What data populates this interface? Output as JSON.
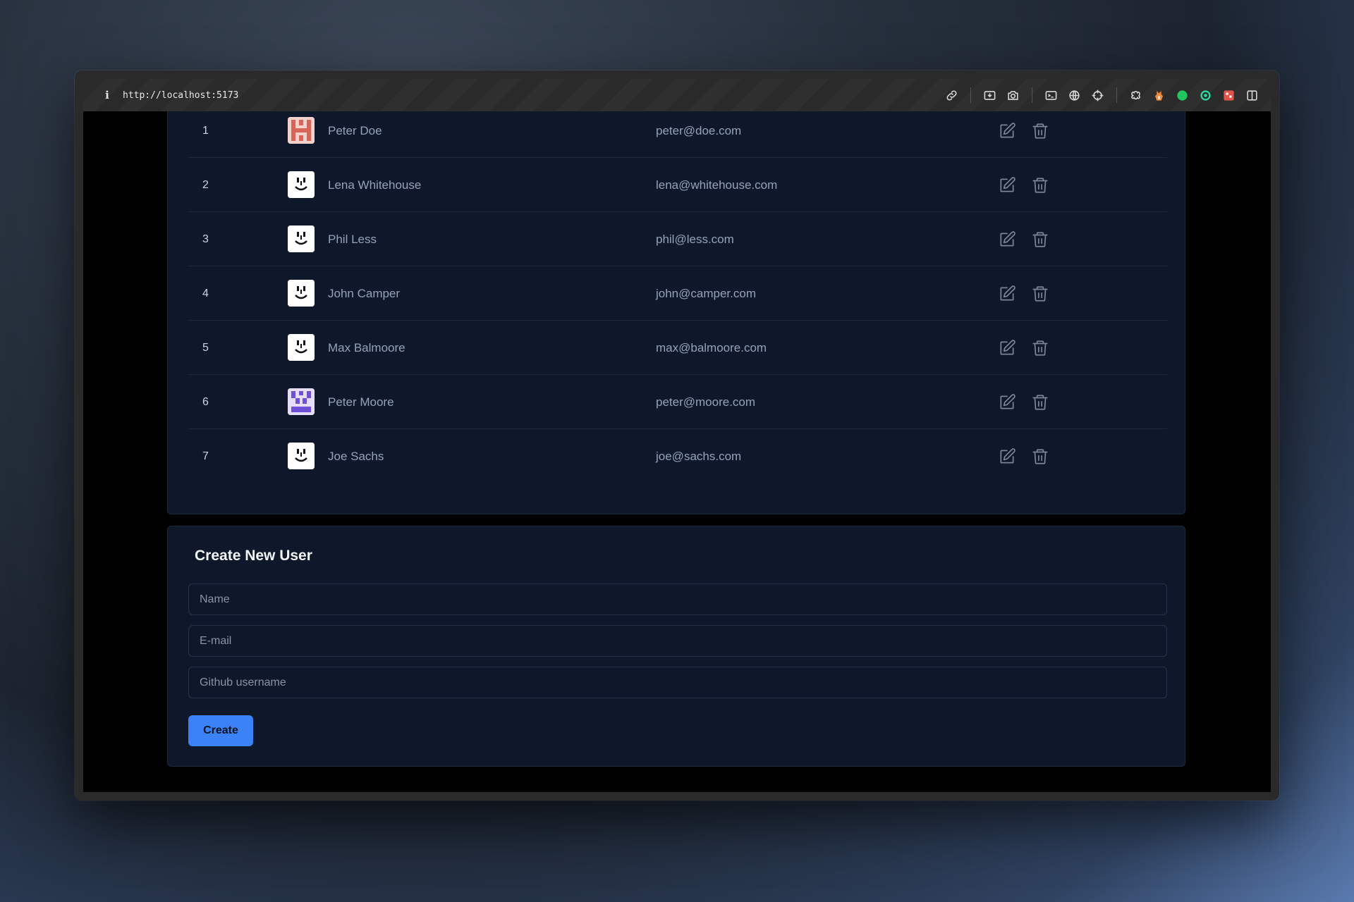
{
  "browser": {
    "url": "http://localhost:5173",
    "toolbar_icons": [
      "link-icon",
      "screenshot-icon",
      "camera-icon",
      "terminal-icon",
      "globe-icon",
      "crosshair-icon",
      "extension-icon",
      "fox-icon",
      "status-dot-icon",
      "target-icon",
      "puzzle-icon",
      "sidebar-icon"
    ],
    "status_dot_color": "#22c55e"
  },
  "users": [
    {
      "id": "1",
      "name": "Peter Doe",
      "email": "peter@doe.com",
      "avatar": "pattern-red"
    },
    {
      "id": "2",
      "name": "Lena Whitehouse",
      "email": "lena@whitehouse.com",
      "avatar": "face"
    },
    {
      "id": "3",
      "name": "Phil Less",
      "email": "phil@less.com",
      "avatar": "face"
    },
    {
      "id": "4",
      "name": "John Camper",
      "email": "john@camper.com",
      "avatar": "face"
    },
    {
      "id": "5",
      "name": "Max Balmoore",
      "email": "max@balmoore.com",
      "avatar": "face"
    },
    {
      "id": "6",
      "name": "Peter Moore",
      "email": "peter@moore.com",
      "avatar": "pattern-purple"
    },
    {
      "id": "7",
      "name": "Joe Sachs",
      "email": "joe@sachs.com",
      "avatar": "face"
    }
  ],
  "form": {
    "title": "Create New User",
    "name_placeholder": "Name",
    "email_placeholder": "E-mail",
    "github_placeholder": "Github username",
    "submit_label": "Create"
  },
  "colors": {
    "accent": "#3b82f6",
    "card_bg": "#0f172a",
    "avatar_red": "#d9655a",
    "avatar_purple": "#6d4fd8"
  }
}
